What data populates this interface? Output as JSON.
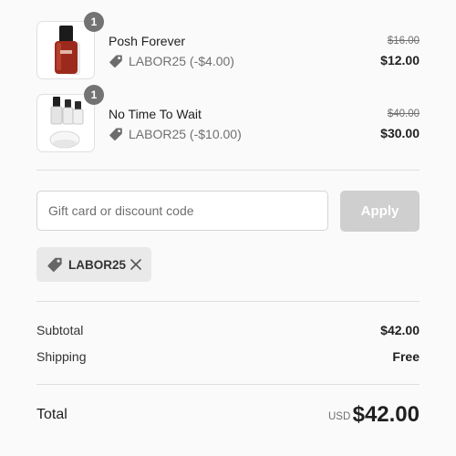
{
  "line_items": [
    {
      "name": "Posh Forever",
      "quantity": "1",
      "discount": "LABOR25 (-$4.00)",
      "original_price": "$16.00",
      "price": "$12.00",
      "image": "red-nail-polish-bottle"
    },
    {
      "name": "No Time To Wait",
      "quantity": "1",
      "discount": "LABOR25 (-$10.00)",
      "original_price": "$40.00",
      "price": "$30.00",
      "image": "nail-kit-with-lamp"
    }
  ],
  "discount_form": {
    "placeholder": "Gift card or discount code",
    "value": "",
    "apply_label": "Apply"
  },
  "applied_code": {
    "code": "LABOR25"
  },
  "summary": {
    "subtotal_label": "Subtotal",
    "subtotal_value": "$42.00",
    "shipping_label": "Shipping",
    "shipping_value": "Free",
    "total_label": "Total",
    "total_currency": "USD",
    "total_value": "$42.00"
  },
  "colors": {
    "background": "#fafafa",
    "apply_disabled": "#cfcfcf",
    "badge": "#737373",
    "chip": "#e9e9e9",
    "muted_text": "#707070"
  }
}
